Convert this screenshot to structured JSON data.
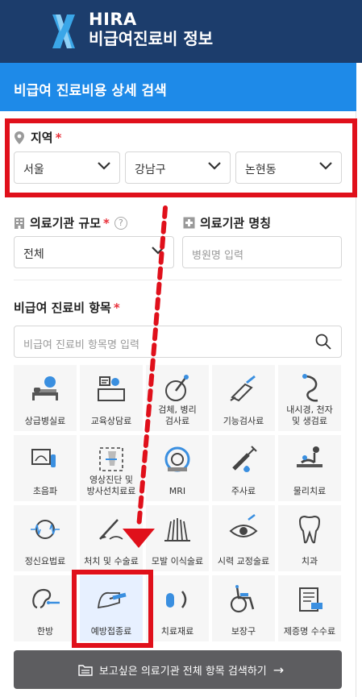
{
  "header": {
    "brand_en": "HIRA",
    "brand_ko": "비급여진료비 정보"
  },
  "section_title": "비급여 진료비용 상세 검색",
  "region": {
    "label": "지역",
    "required_mark": "*",
    "city": "서울",
    "district": "강남구",
    "dong": "논현동"
  },
  "facility_size": {
    "label": "의료기관 규모",
    "required_mark": "*",
    "help": "?",
    "value": "전체"
  },
  "facility_name": {
    "label": "의료기관 명칭",
    "placeholder": "병원명 입력"
  },
  "items": {
    "label": "비급여 진료비 항목",
    "required_mark": "*",
    "search_placeholder": "비급여 진료비 항목명 입력",
    "categories": [
      {
        "label": "상급병실료",
        "icon": "hospital-bed-icon"
      },
      {
        "label": "교육상담료",
        "icon": "counseling-icon"
      },
      {
        "label": "검체, 병리\n검사료",
        "icon": "pathology-test-icon"
      },
      {
        "label": "기능검사료",
        "icon": "function-test-icon"
      },
      {
        "label": "내시경, 천자\n및 생검료",
        "icon": "endoscopy-icon"
      },
      {
        "label": "초음파",
        "icon": "ultrasound-icon"
      },
      {
        "label": "영상진단 및\n방사선치료료",
        "icon": "imaging-icon"
      },
      {
        "label": "MRI",
        "icon": "mri-icon"
      },
      {
        "label": "주사료",
        "icon": "injection-icon"
      },
      {
        "label": "물리치료",
        "icon": "physical-therapy-icon"
      },
      {
        "label": "정신요법료",
        "icon": "psychotherapy-icon"
      },
      {
        "label": "처치 및 수술료",
        "icon": "surgery-icon"
      },
      {
        "label": "모발 이식술료",
        "icon": "hair-transplant-icon"
      },
      {
        "label": "시력 교정술료",
        "icon": "vision-correction-icon"
      },
      {
        "label": "치과",
        "icon": "tooth-icon"
      },
      {
        "label": "한방",
        "icon": "acupuncture-icon"
      },
      {
        "label": "예방접종료",
        "icon": "vaccination-icon"
      },
      {
        "label": "치료재료",
        "icon": "treatment-material-icon"
      },
      {
        "label": "보장구",
        "icon": "wheelchair-icon"
      },
      {
        "label": "제증명 수수료",
        "icon": "certificate-icon"
      }
    ]
  },
  "search_button": {
    "label": "보고싶은 의료기관 전체 항목 검색하기",
    "arrow": "→"
  },
  "colors": {
    "header": "#1c3d6c",
    "accent": "#1e8ae8",
    "annotation": "#e0101b",
    "button": "#5d5d60"
  }
}
